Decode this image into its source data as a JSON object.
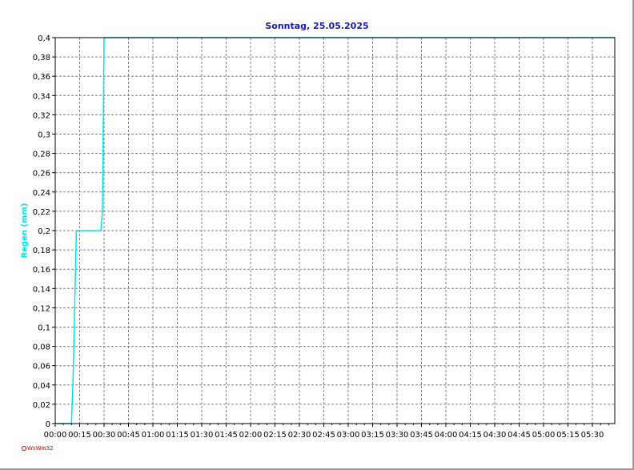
{
  "chart_data": {
    "type": "line",
    "title": "Sonntag, 25.05.2025",
    "ylabel": "Regen (mm)",
    "xlabel": "",
    "ylim": [
      0,
      0.4
    ],
    "y_ticks": [
      "0",
      "0,02",
      "0,04",
      "0,06",
      "0,08",
      "0,1",
      "0,12",
      "0,14",
      "0,16",
      "0,18",
      "0,2",
      "0,22",
      "0,24",
      "0,26",
      "0,28",
      "0,3",
      "0,32",
      "0,34",
      "0,36",
      "0,38",
      "0,4"
    ],
    "x_ticks": [
      "00:00",
      "00:15",
      "00:30",
      "00:45",
      "01:00",
      "01:15",
      "01:30",
      "01:45",
      "02:00",
      "02:15",
      "02:30",
      "02:45",
      "03:00",
      "03:15",
      "03:30",
      "03:45",
      "04:00",
      "04:15",
      "04:30",
      "04:45",
      "05:00",
      "05:15",
      "05:30"
    ],
    "grid": true,
    "series": [
      {
        "color": "#00e5e5",
        "x": [
          "00:00",
          "00:10",
          "00:11",
          "00:13",
          "00:28",
          "00:29",
          "00:30",
          "05:50"
        ],
        "y": [
          0,
          0,
          0.05,
          0.2,
          0.2,
          0.22,
          0.4,
          0.4
        ]
      }
    ]
  },
  "branding": {
    "logo_text": "WsWin32"
  },
  "colors": {
    "title": "#1a1aa8",
    "ylabel": "#00e5e5",
    "grid": "#808080",
    "series": "#00e5e5",
    "top_line": "#000000"
  }
}
